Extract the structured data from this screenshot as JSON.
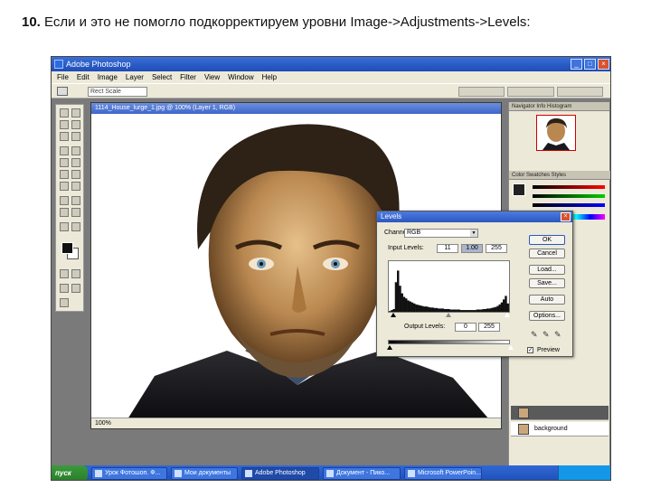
{
  "slide": {
    "number": "10.",
    "text": " Если и это не помогло подкорректируем уровни Image->Adjustments->Levels:"
  },
  "window": {
    "title": "Adobe Photoshop"
  },
  "menu": [
    "File",
    "Edit",
    "Image",
    "Layer",
    "Select",
    "Filter",
    "View",
    "Window",
    "Help"
  ],
  "options": {
    "preset": "Rect Scale"
  },
  "document": {
    "title": "1114_House_lurge_1.jpg @ 100% (Layer 1, RGB)",
    "status": "100%"
  },
  "palettes": {
    "tabs_top": "Navigator  Info  Histogram",
    "tabs_color": "Color  Swatches  Styles",
    "layers": [
      "",
      "background"
    ]
  },
  "levels": {
    "title": "Levels",
    "channel_label": "Channel:",
    "channel_value": "RGB",
    "input_label": "Input Levels:",
    "input": [
      "11",
      "1.00",
      "255"
    ],
    "output_label": "Output Levels:",
    "output": [
      "0",
      "255"
    ],
    "buttons": [
      "OK",
      "Cancel",
      "Load...",
      "Save...",
      "Auto",
      "Options..."
    ],
    "preview_label": "Preview",
    "histogram_heights": [
      0.05,
      0.07,
      0.09,
      0.62,
      0.85,
      0.55,
      0.4,
      0.33,
      0.3,
      0.26,
      0.24,
      0.22,
      0.2,
      0.18,
      0.17,
      0.16,
      0.15,
      0.14,
      0.14,
      0.13,
      0.12,
      0.12,
      0.11,
      0.11,
      0.1,
      0.1,
      0.1,
      0.09,
      0.09,
      0.09,
      0.08,
      0.08,
      0.08,
      0.08,
      0.08,
      0.07,
      0.07,
      0.07,
      0.07,
      0.07,
      0.07,
      0.07,
      0.07,
      0.08,
      0.08,
      0.08,
      0.09,
      0.09,
      0.1,
      0.1,
      0.11,
      0.12,
      0.13,
      0.15,
      0.18,
      0.22,
      0.28,
      0.35,
      0.2,
      0.1
    ]
  },
  "taskbar": {
    "start": "пуск",
    "tasks": [
      "Урок Фотошоп. Ф...",
      "Мои документы",
      "Adobe Photoshop",
      "Документ - Пико...",
      "Microsoft PowerPoin..."
    ]
  }
}
